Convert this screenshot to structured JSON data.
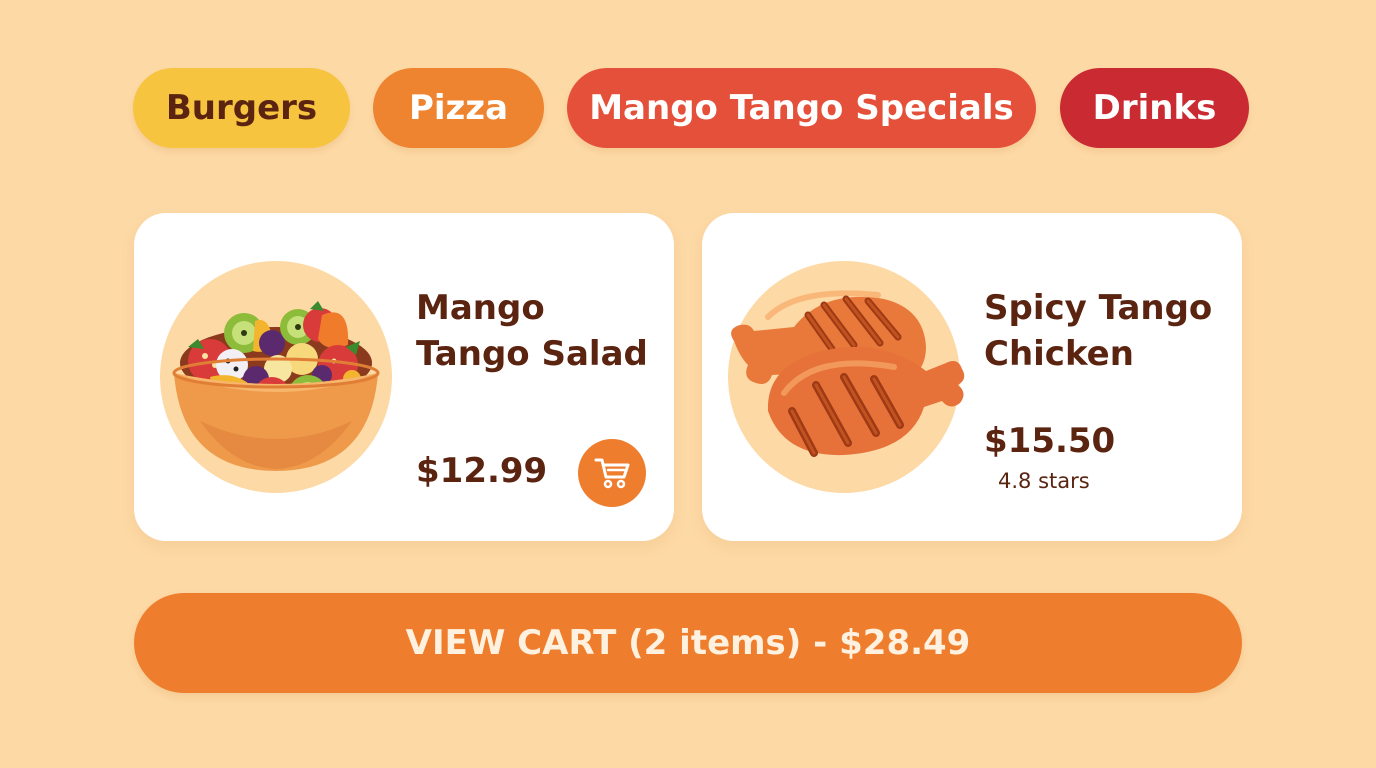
{
  "categories": [
    {
      "label": "Burgers",
      "color": "#F6C43E"
    },
    {
      "label": "Pizza",
      "color": "#EE8330"
    },
    {
      "label": "Mango Tango Specials",
      "color": "#E5503A"
    },
    {
      "label": "Drinks",
      "color": "#CA2A32"
    }
  ],
  "products": [
    {
      "name": "Mango Tango Salad",
      "price": "$12.99",
      "image_icon": "fruit-salad-bowl-icon",
      "action_icon": "shopping-cart-icon"
    },
    {
      "name": "Spicy Tango Chicken",
      "price": "$15.50",
      "rating": "4.8 stars",
      "image_icon": "grilled-chicken-icon"
    }
  ],
  "cart": {
    "label": "VIEW CART (2 items) - $28.49"
  },
  "colors": {
    "background": "#FDD9A5",
    "accent": "#EE7E2D",
    "text": "#5A2410",
    "card": "#FFFFFF"
  }
}
